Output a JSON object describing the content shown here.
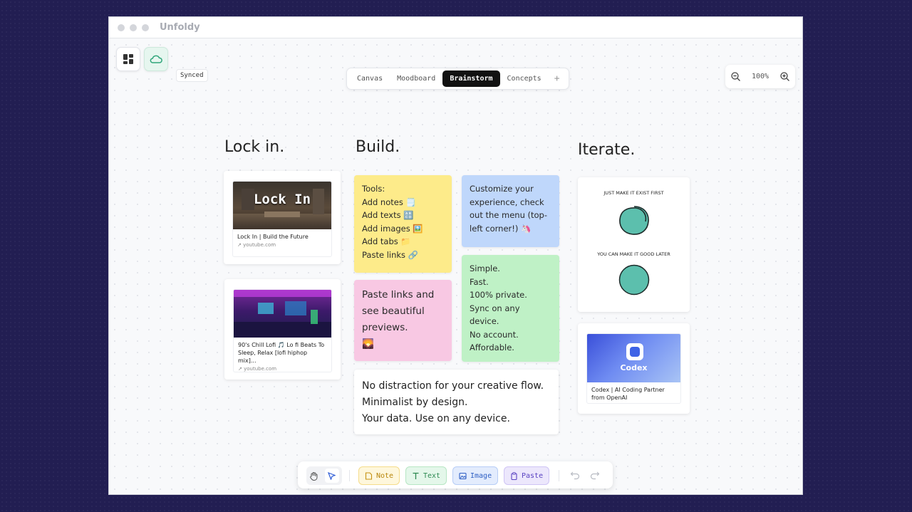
{
  "window": {
    "title": "Unfoldy"
  },
  "header": {
    "sync_status": "Synced",
    "tabs": [
      {
        "label": "Canvas",
        "active": false
      },
      {
        "label": "Moodboard",
        "active": false
      },
      {
        "label": "Brainstorm",
        "active": true
      },
      {
        "label": "Concepts",
        "active": false
      }
    ],
    "add_tab_label": "+",
    "zoom_level": "100%"
  },
  "columns": {
    "lock_in": {
      "heading": "Lock in.",
      "cards": [
        {
          "thumb_text": "Lock In",
          "title": "Lock In | Build the Future",
          "source": "youtube.com"
        },
        {
          "title": "90's Chill Lofi 🎵 Lo fi Beats To Sleep, Relax [lofi hiphop mix]...",
          "source": "youtube.com"
        }
      ]
    },
    "build": {
      "heading": "Build.",
      "tools_note": {
        "title": "Tools:",
        "lines": [
          "Add notes 🗒️",
          "Add texts 🔠",
          "Add images 🖼️",
          "Add tabs 📁",
          "Paste links 🔗"
        ]
      },
      "customize_note": "Customize your experience, check out the menu (top-left corner!) 🦄",
      "paste_note": "Paste links and see beautiful previews.",
      "paste_note_emoji": "🌄",
      "features_note": [
        "Simple.",
        "Fast.",
        "100% private.",
        "Sync on any device.",
        "No account.",
        "Affordable."
      ],
      "text_card": [
        "No distraction for your creative flow.",
        "Minimalist by design.",
        "Your data. Use on any device."
      ]
    },
    "iterate": {
      "heading": "Iterate.",
      "sketch_top": "JUST MAKE IT EXIST FIRST",
      "sketch_bottom": "YOU CAN MAKE IT GOOD LATER",
      "codex_card": {
        "thumb_text": "Codex",
        "title": "Codex | AI Coding Partner from OpenAI"
      }
    }
  },
  "toolbar": {
    "note_label": "Note",
    "text_label": "Text",
    "image_label": "Image",
    "paste_label": "Paste"
  },
  "colors": {
    "note_yellow": "#fdeb8a",
    "note_blue": "#bfd7fb",
    "note_pink": "#f8c8e3",
    "note_green": "#bff1c6",
    "circle_teal": "#5cbfad"
  }
}
